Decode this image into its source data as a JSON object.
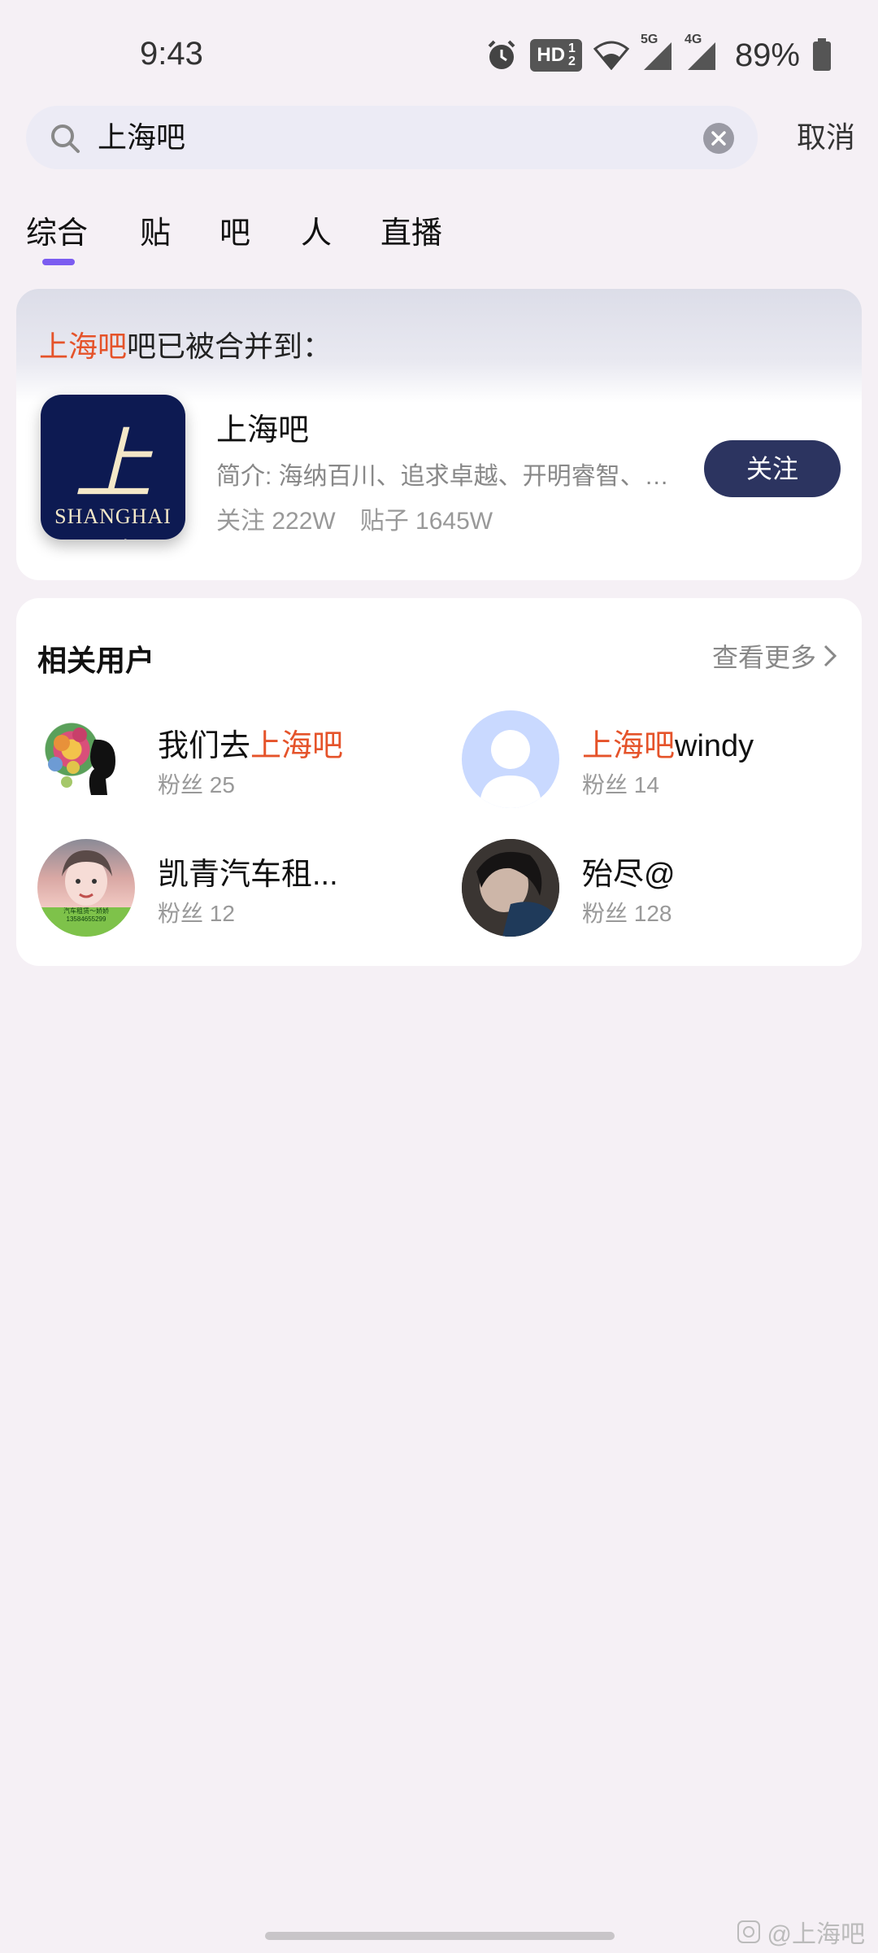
{
  "status_bar": {
    "time": "9:43",
    "hd_label": "HD",
    "net1": "5G",
    "net2": "4G",
    "battery": "89%"
  },
  "search": {
    "query": "上海吧",
    "cancel_label": "取消"
  },
  "tabs": [
    {
      "label": "综合",
      "active": true
    },
    {
      "label": "贴"
    },
    {
      "label": "吧"
    },
    {
      "label": "人"
    },
    {
      "label": "直播"
    }
  ],
  "merge_card": {
    "notice_highlight": "上海吧",
    "notice_rest": "吧已被合并到：",
    "logo_script": "上海",
    "logo_text": "SHANGHAI",
    "bar_name": "上海吧",
    "intro": "简介: 海纳百川、追求卓越、开明睿智、大气谦和",
    "followers": "关注 222W",
    "posts": "贴子 1645W",
    "follow_label": "关注"
  },
  "related_users": {
    "title": "相关用户",
    "see_more": "查看更多",
    "users": [
      {
        "name_plain": "我们去",
        "name_hl": "上海吧",
        "name_after": "",
        "fans": "粉丝 25"
      },
      {
        "name_plain": "",
        "name_hl": "上海吧",
        "name_after": "windy",
        "fans": "粉丝 14"
      },
      {
        "name_plain": "凯青汽车租...",
        "name_hl": "",
        "name_after": "",
        "fans": "粉丝 12",
        "avatar_caption": "汽车租赁～娇娇 13584655299"
      },
      {
        "name_plain": "殆尽@",
        "name_hl": "",
        "name_after": "",
        "fans": "粉丝 128"
      }
    ]
  },
  "watermark": "@上海吧",
  "colors": {
    "highlight": "#e5532a",
    "accent": "#7b5cf0",
    "follow_button": "#2c3460"
  }
}
